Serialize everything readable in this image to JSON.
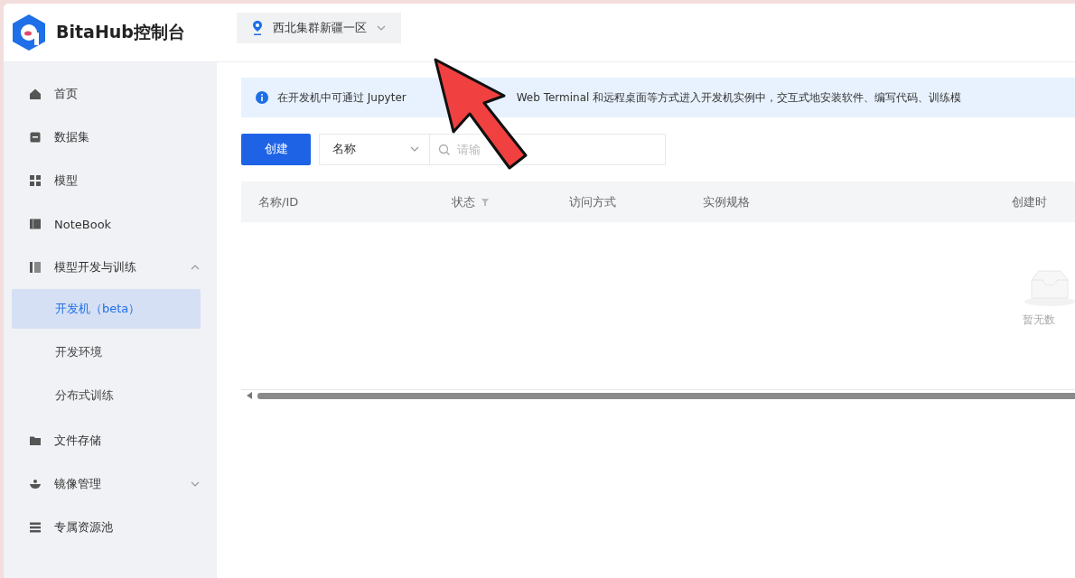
{
  "header": {
    "brand": "BitaHub控制台",
    "region_selector": {
      "value": "西北集群新疆一区"
    }
  },
  "sidebar": {
    "items": [
      {
        "label": "首页",
        "selected": false
      },
      {
        "label": "数据集",
        "selected": false
      },
      {
        "label": "模型",
        "selected": false
      },
      {
        "label": "NoteBook",
        "selected": false
      },
      {
        "label": "模型开发与训练",
        "selected": false,
        "expanded": true,
        "children": [
          {
            "label": "开发机（beta）",
            "selected": true
          },
          {
            "label": "开发环境",
            "selected": false
          },
          {
            "label": "分布式训练",
            "selected": false
          }
        ]
      },
      {
        "label": "文件存储",
        "selected": false
      },
      {
        "label": "镜像管理",
        "selected": false,
        "expanded": false
      },
      {
        "label": "专属资源池",
        "selected": false
      }
    ]
  },
  "info_banner": {
    "text_parts": [
      "在开发机中可通过 Jupyter",
      "Web Terminal 和远程桌面等方式进入开发机实例中，交互式地安装软件、编写代码、训练模"
    ]
  },
  "toolbar": {
    "create_button": "创建",
    "filter_select": {
      "value": "名称"
    },
    "search": {
      "placeholder": "请输"
    }
  },
  "table": {
    "columns": [
      {
        "label": "名称/ID",
        "filter": false
      },
      {
        "label": "状态",
        "filter": true
      },
      {
        "label": "访问方式",
        "filter": false
      },
      {
        "label": "实例规格",
        "filter": false
      },
      {
        "label": "创建时",
        "filter": false
      }
    ],
    "empty_text": "暂无数"
  },
  "annotation": {
    "kind": "arrow"
  }
}
